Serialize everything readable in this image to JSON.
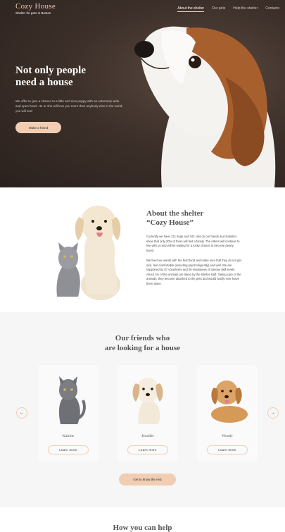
{
  "header": {
    "brand": "Cozy House",
    "tagline": "Shelter for pets in Boston",
    "nav": [
      "About the shelter",
      "Our pets",
      "Help the shelter",
      "Contacts"
    ]
  },
  "hero": {
    "heading_line1": "Not only people",
    "heading_line2": "need a house",
    "text": "We offer to give a chance to a little and nice puppy with an extremely wide and open heart. He or she will love you more than anybody else in the world, you will see!",
    "button": "Make a friend"
  },
  "about": {
    "heading_line1": "About the shelter",
    "heading_line2": "“Cozy House”",
    "paragraph1": "Currently we have 121 dogs and 342 cats on our hands and statistics show that only 20% of them will find a family. The others will continue to live with us and will be waiting for a lucky chance to become dearly loved.",
    "paragraph2": "We feed our wards with the best food and make sure that they do not get sick, feel comfortable (including psychologically) and well. We are supported by 87 volunteers and 28 employees of various skill levels. About 1% of the animals are taken by the shelter staff. Taking care of the animals, they become attached to the pets and would hardly ever leave them alone."
  },
  "friends": {
    "heading_line1": "Our friends who",
    "heading_line2": "are looking for a house",
    "prev_arrow": "←",
    "next_arrow": "→",
    "cards": [
      {
        "name": "Katrine",
        "button": "Learn more"
      },
      {
        "name": "Jennifer",
        "button": "Learn more"
      },
      {
        "name": "Woody",
        "button": "Learn more"
      }
    ],
    "rest_button": "Get to know the rest"
  },
  "help": {
    "heading": "How you can help"
  },
  "colors": {
    "accent": "#f1cdb3",
    "hero_bg": "#3d302a",
    "section_bg": "#f6f6f6"
  }
}
